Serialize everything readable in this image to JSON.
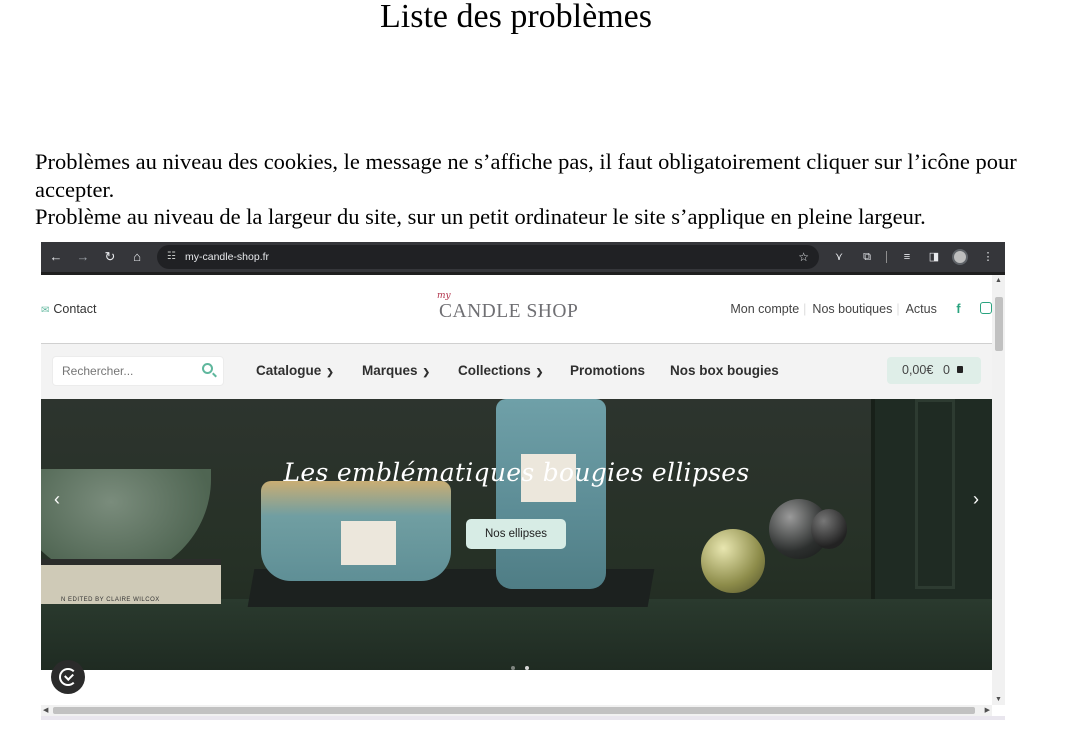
{
  "document": {
    "title": "Liste des problèmes",
    "problems": [
      "Problèmes au niveau des cookies, le message ne s’affiche pas, il faut obligatoirement cliquer sur l’icône pour accepter.",
      "Problème au niveau de la largeur du site, sur un petit ordinateur le site s’applique en pleine largeur."
    ]
  },
  "browser": {
    "url": "my-candle-shop.fr",
    "icons": [
      "back-arrow-icon",
      "forward-arrow-icon",
      "reload-icon",
      "home-icon",
      "site-info-icon",
      "bookmark-star-icon",
      "extension-icon",
      "puzzle-icon",
      "media-icon",
      "side-panel-icon",
      "profile-avatar-icon",
      "more-menu-icon"
    ]
  },
  "site": {
    "contact_label": "Contact",
    "logo": {
      "script": "my",
      "name": "CANDLE SHOP"
    },
    "top_links": [
      "Mon compte",
      "Nos boutiques",
      "Actus"
    ],
    "search_placeholder": "Rechercher...",
    "menu": [
      {
        "label": "Catalogue",
        "dropdown": true
      },
      {
        "label": "Marques",
        "dropdown": true
      },
      {
        "label": "Collections",
        "dropdown": true
      },
      {
        "label": "Promotions",
        "dropdown": false
      },
      {
        "label": "Nos box bougies",
        "dropdown": false
      }
    ],
    "cart": {
      "price": "0,00€",
      "count": "0"
    },
    "hero": {
      "title": "Les emblématiques bougies ellipses",
      "button": "Nos ellipses",
      "book_text": "N    EDITED BY CLAIRE WILCOX",
      "slides": 2,
      "active_slide": 2
    },
    "colors": {
      "accent": "#5fb79d",
      "cart_bg": "#dfeee8",
      "hero_button_bg": "#d7ece5",
      "logo_script": "#b03048"
    }
  }
}
